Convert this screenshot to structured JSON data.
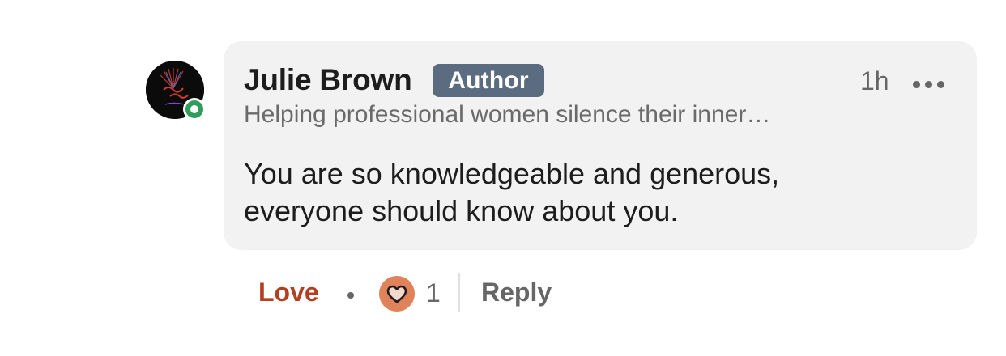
{
  "comment": {
    "author_name": "Julie Brown",
    "author_badge": "Author",
    "timestamp": "1h",
    "author_headline": "Helping professional women silence their inner…",
    "text_line1": "You are so knowledgeable and generous,",
    "text_line2": "everyone should know about you.",
    "presence_status": "online",
    "more_icon": "ellipsis-icon"
  },
  "actions": {
    "love_label": "Love",
    "reaction_icon": "heart-reaction-icon",
    "reaction_count": "1",
    "reply_label": "Reply"
  },
  "colors": {
    "bubble_bg": "#f2f2f2",
    "badge_bg": "#5b6c80",
    "love_color": "#b24020",
    "presence_green": "#2f9e5a",
    "reaction_bg": "#e0825a"
  }
}
